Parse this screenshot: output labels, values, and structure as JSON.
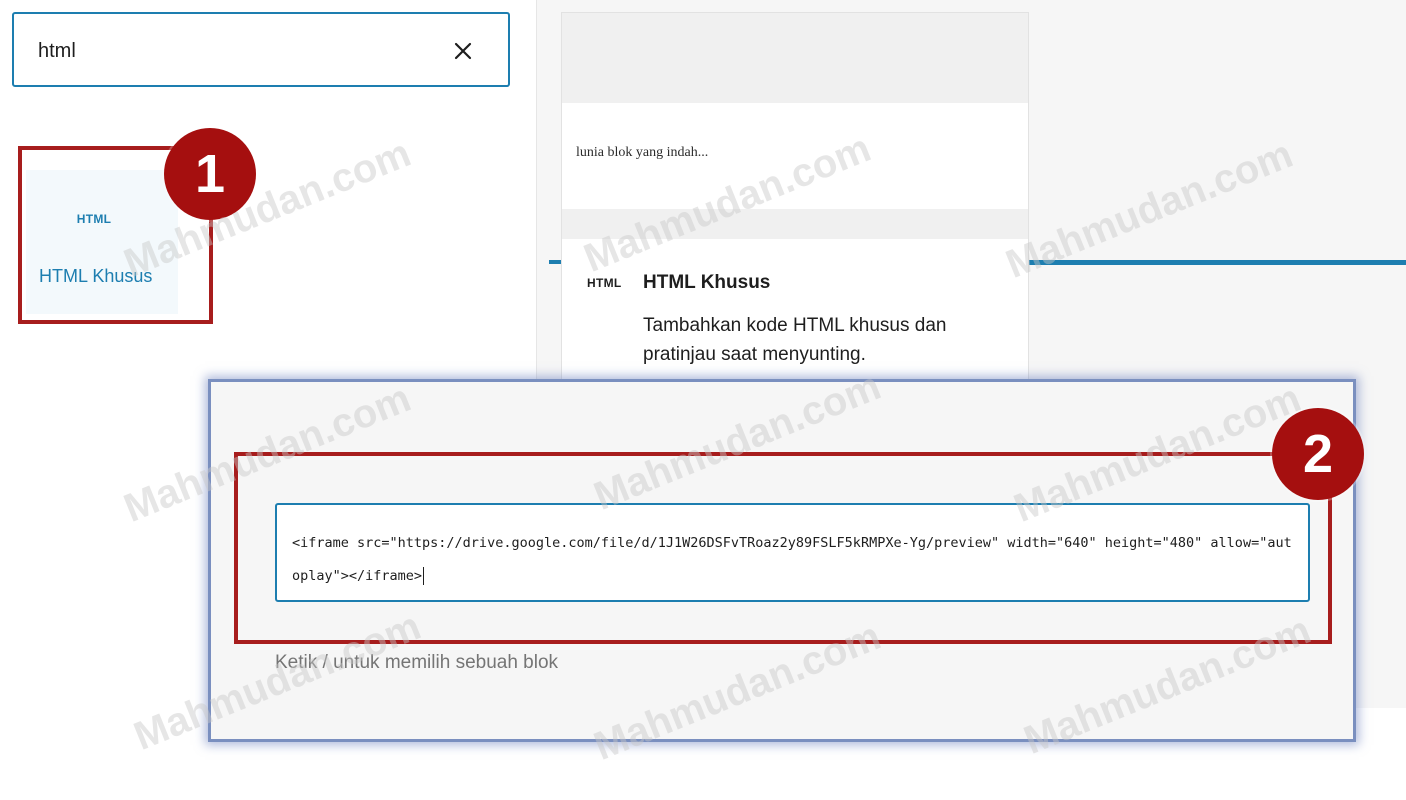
{
  "search": {
    "value": "html",
    "clear_label": "×"
  },
  "inserter": {
    "block": {
      "icon_text": "HTML",
      "label": "HTML Khusus"
    }
  },
  "markers": {
    "first": "1",
    "second": "2"
  },
  "preview": {
    "snippet": "lunia blok yang indah...",
    "icon_text": "HTML",
    "title": "HTML Khusus",
    "description": "Tambahkan kode HTML khusus dan pratinjau saat menyunting."
  },
  "editor": {
    "code": "<iframe src=\"https://drive.google.com/file/d/1J1W26DSFvTRoaz2y89FSLF5kRMPXe-Yg/preview\" width=\"640\" height=\"480\" allow=\"autoplay\"></iframe>",
    "hint": "Ketik / untuk memilih sebuah blok"
  },
  "watermark": "Mahmudan.com",
  "colors": {
    "accent": "#1d7eb0",
    "marker": "#a71d1d",
    "badge": "#a50f0f"
  }
}
